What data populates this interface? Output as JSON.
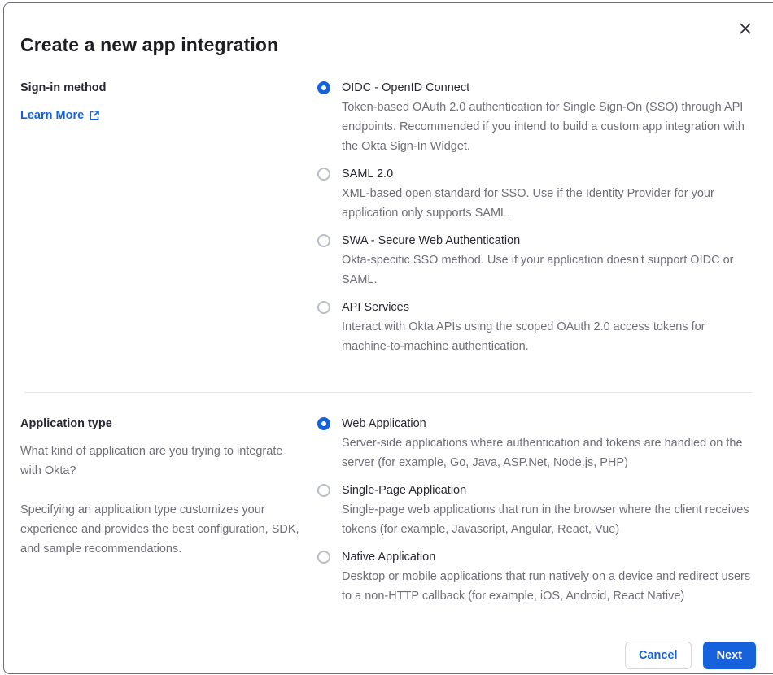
{
  "dialog": {
    "title": "Create a new app integration"
  },
  "signin_section": {
    "heading": "Sign-in method",
    "learn_more_label": "Learn More",
    "options": [
      {
        "label": "OIDC - OpenID Connect",
        "description": "Token-based OAuth 2.0 authentication for Single Sign-On (SSO) through API endpoints. Recommended if you intend to build a custom app integration with the Okta Sign-In Widget.",
        "selected": true
      },
      {
        "label": "SAML 2.0",
        "description": "XML-based open standard for SSO. Use if the Identity Provider for your application only supports SAML.",
        "selected": false
      },
      {
        "label": "SWA - Secure Web Authentication",
        "description": "Okta-specific SSO method. Use if your application doesn't support OIDC or SAML.",
        "selected": false
      },
      {
        "label": "API Services",
        "description": "Interact with Okta APIs using the scoped OAuth 2.0 access tokens for machine-to-machine authentication.",
        "selected": false
      }
    ]
  },
  "apptype_section": {
    "heading": "Application type",
    "description_1": "What kind of application are you trying to integrate with Okta?",
    "description_2": "Specifying an application type customizes your experience and provides the best configuration, SDK, and sample recommendations.",
    "options": [
      {
        "label": "Web Application",
        "description": "Server-side applications where authentication and tokens are handled on the server (for example, Go, Java, ASP.Net, Node.js, PHP)",
        "selected": true
      },
      {
        "label": "Single-Page Application",
        "description": "Single-page web applications that run in the browser where the client receives tokens (for example, Javascript, Angular, React, Vue)",
        "selected": false
      },
      {
        "label": "Native Application",
        "description": "Desktop or mobile applications that run natively on a device and redirect users to a non-HTTP callback (for example, iOS, Android, React Native)",
        "selected": false
      }
    ]
  },
  "footer": {
    "cancel_label": "Cancel",
    "next_label": "Next"
  },
  "colors": {
    "accent_blue": "#1662dd",
    "text_dark": "#272833",
    "text_muted": "#6e6e78",
    "border_gray": "#d7d7dc",
    "divider_gray": "#e4e4e9"
  }
}
